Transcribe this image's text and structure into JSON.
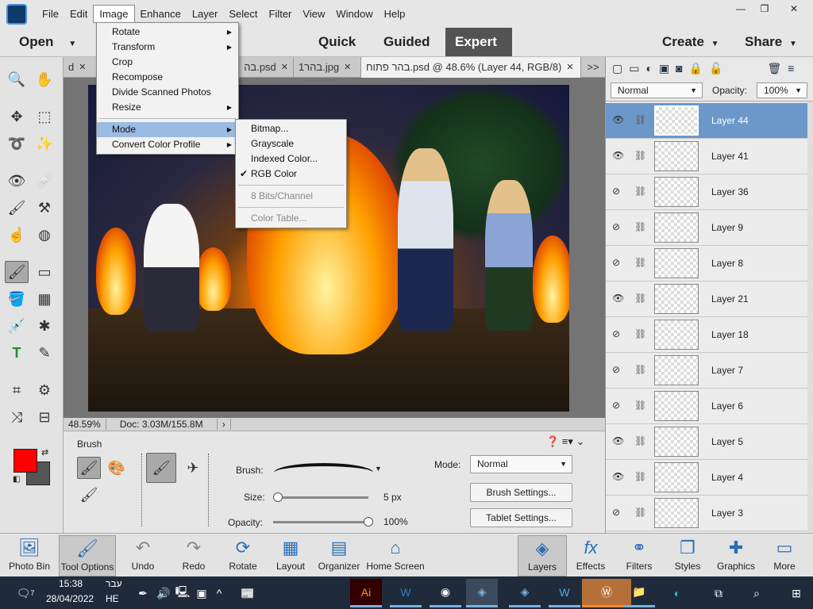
{
  "menubar": {
    "items": [
      "File",
      "Edit",
      "Image",
      "Enhance",
      "Layer",
      "Select",
      "Filter",
      "View",
      "Window",
      "Help"
    ],
    "open": "Image",
    "window_controls": [
      "minimize",
      "restore",
      "close"
    ]
  },
  "modebar": {
    "open": "Open",
    "modes": [
      "Quick",
      "Guided",
      "Expert"
    ],
    "active_mode": "Expert",
    "create": "Create",
    "share": "Share"
  },
  "tabs": [
    {
      "label": "d"
    },
    {
      "label": "בה.psd"
    },
    {
      "label": "1בהר.jpg"
    },
    {
      "label": "בהר פתוח.psd @ 48.6% (Layer 44, RGB/8)",
      "active": true
    }
  ],
  "tabs_overflow": ">>",
  "image_menu": {
    "items": [
      {
        "label": "Rotate",
        "sub": true
      },
      {
        "label": "Transform",
        "sub": true
      },
      {
        "label": "Crop"
      },
      {
        "label": "Recompose"
      },
      {
        "label": "Divide Scanned Photos"
      },
      {
        "label": "Resize",
        "sub": true
      },
      {
        "label": "Mode",
        "sub": true,
        "highlighted": true
      },
      {
        "label": "Convert Color Profile",
        "sub": true
      }
    ]
  },
  "mode_submenu": {
    "items": [
      {
        "label": "Bitmap..."
      },
      {
        "label": "Grayscale"
      },
      {
        "label": "Indexed Color..."
      },
      {
        "label": "RGB Color",
        "checked": true
      },
      {
        "label": "8 Bits/Channel",
        "disabled": true
      },
      {
        "label": "Color Table...",
        "disabled": true
      }
    ]
  },
  "status": {
    "zoom": "48.59%",
    "doc": "Doc: 3.03M/155.8M"
  },
  "tool_options": {
    "title": "Brush",
    "brush_label": "Brush:",
    "size_label": "Size:",
    "size_value": "5 px",
    "size_fraction": 0.0,
    "opacity_label": "Opacity:",
    "opacity_value": "100%",
    "opacity_fraction": 1.0,
    "mode_label": "Mode:",
    "mode_value": "Normal",
    "brush_settings": "Brush Settings...",
    "tablet_settings": "Tablet Settings..."
  },
  "colors": {
    "foreground": "#ff0000",
    "background": "#555555",
    "accent": "#6c98c9"
  },
  "layers_panel": {
    "blend_mode": "Normal",
    "opacity_label": "Opacity:",
    "opacity_value": "100%",
    "layers": [
      {
        "name": "Layer 44",
        "visible": true,
        "selected": true
      },
      {
        "name": "Layer 41",
        "visible": true
      },
      {
        "name": "Layer 36",
        "visible": false
      },
      {
        "name": "Layer 9",
        "visible": false
      },
      {
        "name": "Layer 8",
        "visible": false
      },
      {
        "name": "Layer 21",
        "visible": true
      },
      {
        "name": "Layer 18",
        "visible": false
      },
      {
        "name": "Layer 7",
        "visible": false
      },
      {
        "name": "Layer 6",
        "visible": false
      },
      {
        "name": "Layer 5",
        "visible": true
      },
      {
        "name": "Layer 4",
        "visible": true
      },
      {
        "name": "Layer 3",
        "visible": false
      }
    ]
  },
  "panel_bar": {
    "left": [
      "Photo Bin",
      "Tool Options",
      "Undo",
      "Redo",
      "Rotate",
      "Layout",
      "Organizer",
      "Home Screen"
    ],
    "right": [
      "Layers",
      "Effects",
      "Filters",
      "Styles",
      "Graphics",
      "More"
    ]
  },
  "taskbar": {
    "time": "15:38",
    "date": "28/04/2022",
    "lang_top": "עבר",
    "lang": "HE",
    "notifications": "7"
  }
}
